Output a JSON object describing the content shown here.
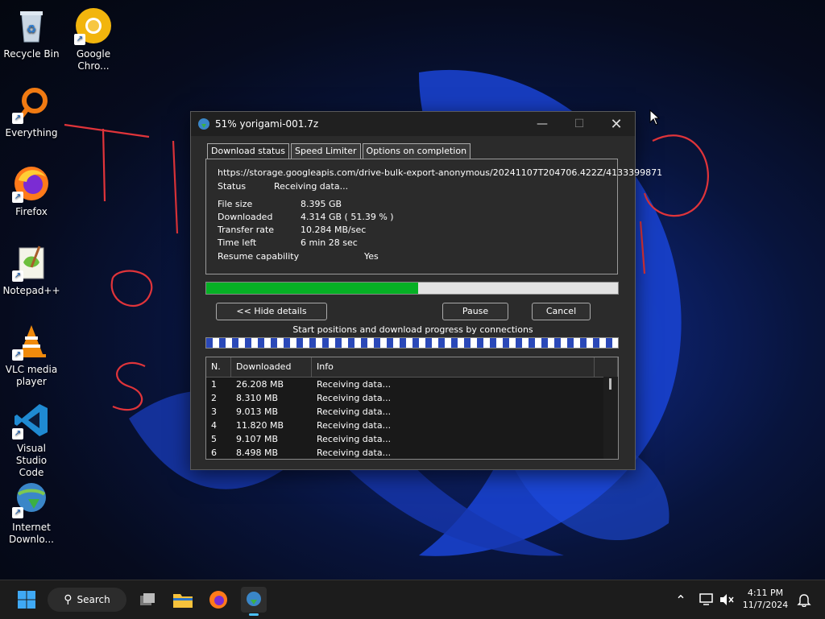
{
  "desktop": {
    "icons": [
      {
        "label": "Recycle Bin",
        "icon": "recycle-bin-icon"
      },
      {
        "label": "Google\nChro...",
        "icon": "chrome-icon"
      },
      {
        "label": "Everything",
        "icon": "everything-search-icon"
      },
      {
        "label": "Firefox",
        "icon": "firefox-icon"
      },
      {
        "label": "Notepad++",
        "icon": "notepadpp-icon"
      },
      {
        "label": "VLC media\nplayer",
        "icon": "vlc-icon"
      },
      {
        "label": "Visual Studio\nCode",
        "icon": "vscode-icon"
      },
      {
        "label": "Internet\nDownlo...",
        "icon": "idm-icon"
      }
    ]
  },
  "dialog": {
    "title": "51% yorigami-001.7z",
    "tabs": [
      "Download status",
      "Speed Limiter",
      "Options on completion"
    ],
    "url": "https://storage.googleapis.com/drive-bulk-export-anonymous/20241107T204706.422Z/4133399871",
    "status": {
      "label": "Status",
      "value": "Receiving data..."
    },
    "file_size": {
      "label": "File size",
      "value": "8.395  GB"
    },
    "downloaded": {
      "label": "Downloaded",
      "value": "4.314  GB  ( 51.39 % )"
    },
    "transfer_rate": {
      "label": "Transfer rate",
      "value": "10.284  MB/sec"
    },
    "time_left": {
      "label": "Time left",
      "value": "6 min 28 sec"
    },
    "resume": {
      "label": "Resume capability",
      "value": "Yes"
    },
    "progress_percent": 51.39,
    "buttons": {
      "hide_details": "<< Hide details",
      "pause": "Pause",
      "cancel": "Cancel"
    },
    "connections_caption": "Start positions and download progress by connections",
    "table": {
      "headers": [
        "N.",
        "Downloaded",
        "Info"
      ],
      "rows": [
        {
          "n": "1",
          "downloaded": "26.208  MB",
          "info": "Receiving data..."
        },
        {
          "n": "2",
          "downloaded": "8.310  MB",
          "info": "Receiving data..."
        },
        {
          "n": "3",
          "downloaded": "9.013  MB",
          "info": "Receiving data..."
        },
        {
          "n": "4",
          "downloaded": "11.820  MB",
          "info": "Receiving data..."
        },
        {
          "n": "5",
          "downloaded": "9.107  MB",
          "info": "Receiving data..."
        },
        {
          "n": "6",
          "downloaded": "8.498  MB",
          "info": "Receiving data..."
        }
      ]
    }
  },
  "taskbar": {
    "search_label": "Search",
    "time": "4:11 PM",
    "date": "11/7/2024"
  }
}
